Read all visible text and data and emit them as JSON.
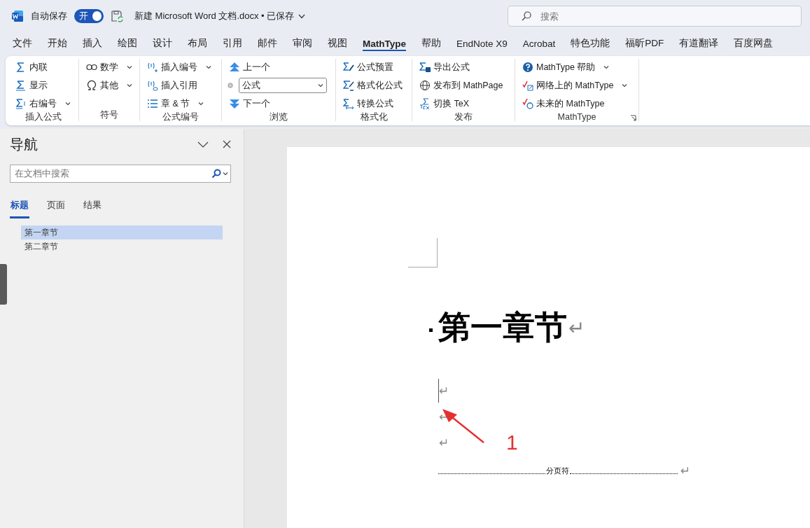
{
  "titlebar": {
    "autosave_label": "自动保存",
    "autosave": {
      "label": "开",
      "on": true
    },
    "document_title": "新建 Microsoft Word 文档.docx • 已保存",
    "search": {
      "placeholder": "搜索"
    }
  },
  "menu_tabs": [
    {
      "label": "文件",
      "selected": false
    },
    {
      "label": "开始",
      "selected": false
    },
    {
      "label": "插入",
      "selected": false
    },
    {
      "label": "绘图",
      "selected": false
    },
    {
      "label": "设计",
      "selected": false
    },
    {
      "label": "布局",
      "selected": false
    },
    {
      "label": "引用",
      "selected": false
    },
    {
      "label": "邮件",
      "selected": false
    },
    {
      "label": "审阅",
      "selected": false
    },
    {
      "label": "视图",
      "selected": false
    },
    {
      "label": "MathType",
      "selected": true
    },
    {
      "label": "帮助",
      "selected": false
    },
    {
      "label": "EndNote X9",
      "selected": false
    },
    {
      "label": "Acrobat",
      "selected": false
    },
    {
      "label": "特色功能",
      "selected": false
    },
    {
      "label": "福昕PDF",
      "selected": false
    },
    {
      "label": "有道翻译",
      "selected": false
    },
    {
      "label": "百度网盘",
      "selected": false
    }
  ],
  "ribbon": {
    "groups": [
      {
        "label": "插入公式",
        "items": [
          {
            "kind": "button",
            "label": "内联",
            "dropdown": false
          },
          {
            "kind": "button",
            "label": "显示",
            "dropdown": false
          },
          {
            "kind": "button",
            "label": "右编号",
            "dropdown": true
          }
        ]
      },
      {
        "label": "符号",
        "items": [
          {
            "kind": "button",
            "label": "数学",
            "dropdown": true
          },
          {
            "kind": "button",
            "label": "其他",
            "dropdown": true
          }
        ]
      },
      {
        "label": "公式编号",
        "items": [
          {
            "kind": "button",
            "label": "插入编号",
            "dropdown": true
          },
          {
            "kind": "button",
            "label": "插入引用",
            "dropdown": false
          },
          {
            "kind": "button",
            "label": "章 & 节",
            "dropdown": true
          }
        ]
      },
      {
        "label": "浏览",
        "items": [
          {
            "kind": "button",
            "label": "上一个",
            "dropdown": false
          },
          {
            "kind": "select",
            "value": "公式"
          },
          {
            "kind": "button",
            "label": "下一个",
            "dropdown": false
          }
        ]
      },
      {
        "label": "格式化",
        "items": [
          {
            "kind": "button",
            "label": "公式预置",
            "dropdown": false
          },
          {
            "kind": "button",
            "label": "格式化公式",
            "dropdown": false
          },
          {
            "kind": "button",
            "label": "转换公式",
            "dropdown": false
          }
        ]
      },
      {
        "label": "发布",
        "items": [
          {
            "kind": "button",
            "label": "导出公式",
            "dropdown": false
          },
          {
            "kind": "button",
            "label": "发布到 MathPage",
            "dropdown": false
          },
          {
            "kind": "button",
            "label": "切换 TeX",
            "dropdown": false
          }
        ]
      },
      {
        "label": "MathType",
        "items": [
          {
            "kind": "button",
            "label": "MathType 帮助",
            "dropdown": true
          },
          {
            "kind": "button",
            "label": "网络上的 MathType",
            "dropdown": true
          },
          {
            "kind": "button",
            "label": "未来的 MathType",
            "dropdown": false
          }
        ]
      }
    ]
  },
  "navigation": {
    "title": "导航",
    "search": {
      "placeholder": "在文档中搜索"
    },
    "tabs": [
      {
        "label": "标题",
        "selected": true
      },
      {
        "label": "页面",
        "selected": false
      },
      {
        "label": "结果",
        "selected": false
      }
    ],
    "headings": [
      {
        "label": "第一章节",
        "selected": true
      },
      {
        "label": "第二章节",
        "selected": false
      }
    ]
  },
  "document": {
    "heading": {
      "text": "第一章节",
      "mark": "↵"
    },
    "paragraphs": [
      {
        "mark": "↵",
        "cursor": true
      },
      {
        "mark": "↵",
        "cursor": false
      },
      {
        "mark": "↵",
        "cursor": false
      }
    ],
    "page_break": {
      "label": "分页符",
      "mark": "↵"
    },
    "annotation": {
      "label": "1"
    }
  }
}
